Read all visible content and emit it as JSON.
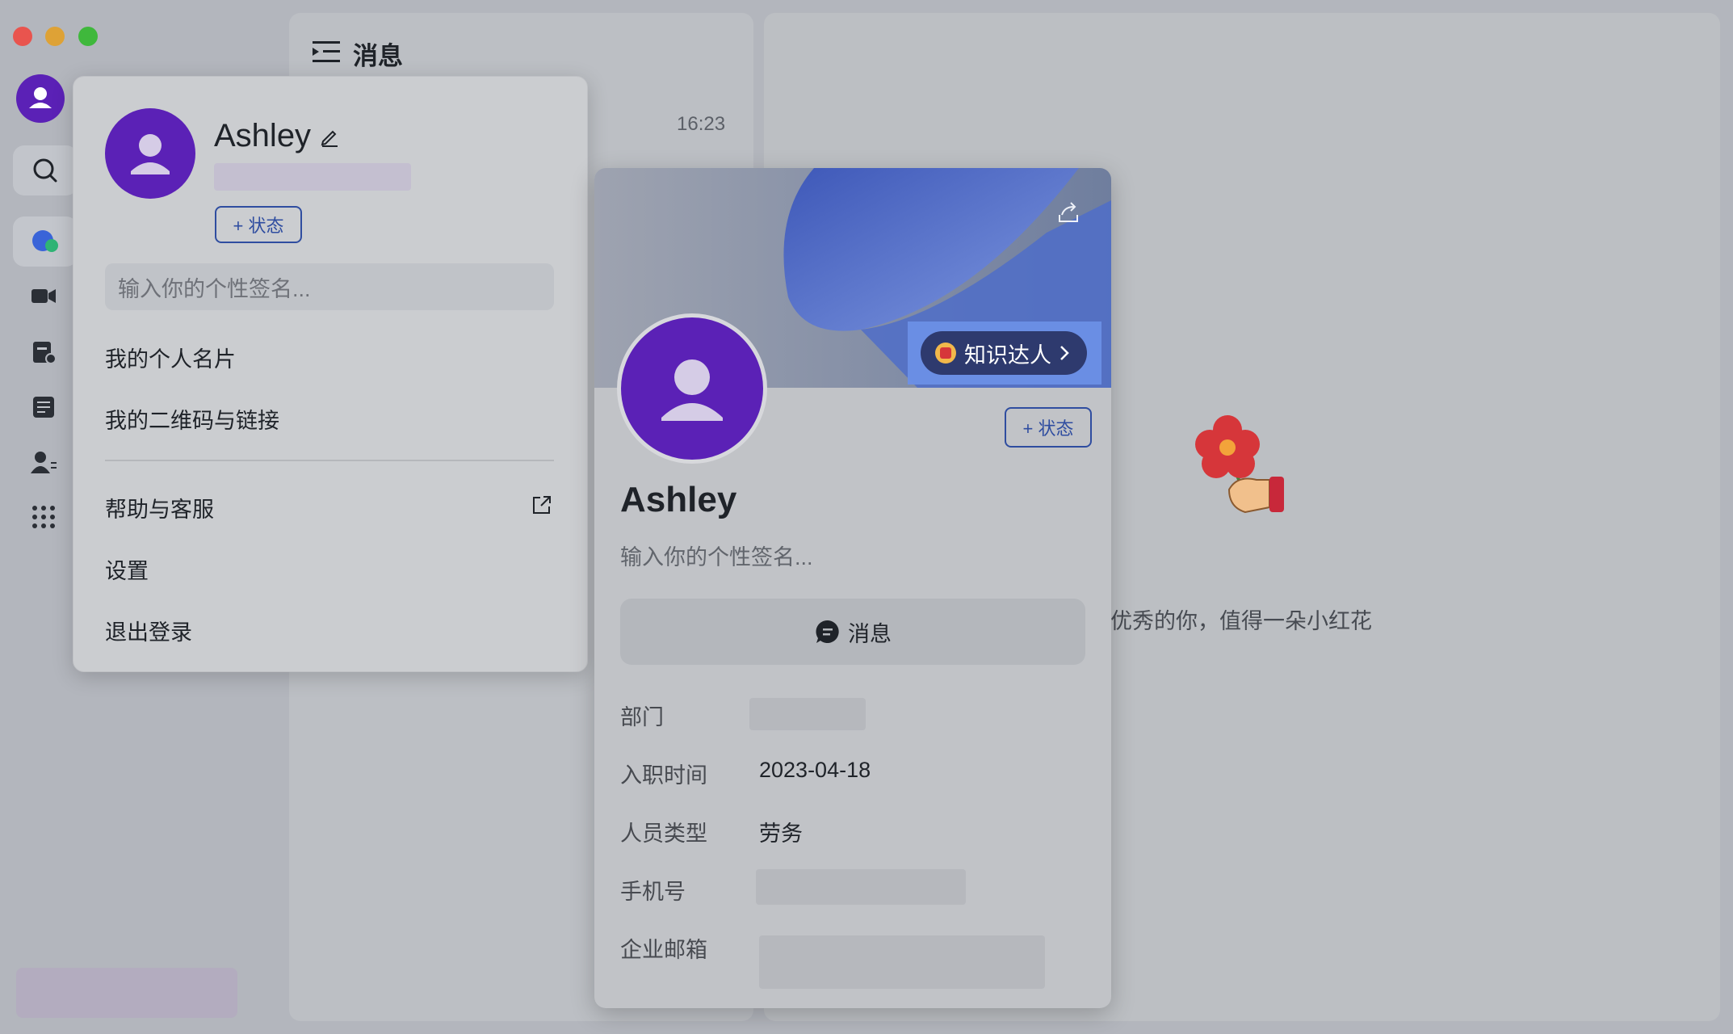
{
  "panel": {
    "title": "消息",
    "time": "16:23"
  },
  "main": {
    "empty_text": "优秀的你，值得一朵小红花"
  },
  "menu": {
    "name": "Ashley",
    "status_button": "+ 状态",
    "signature_placeholder": "输入你的个性签名...",
    "items": {
      "card": "我的个人名片",
      "qrcode": "我的二维码与链接",
      "help": "帮助与客服",
      "settings": "设置",
      "logout": "退出登录"
    }
  },
  "card": {
    "badge": "知识达人",
    "status_button": "+ 状态",
    "name": "Ashley",
    "signature_placeholder": "输入你的个性签名...",
    "message_button": "消息",
    "fields": {
      "department_label": "部门",
      "join_date_label": "入职时间",
      "join_date": "2023-04-18",
      "staff_type_label": "人员类型",
      "staff_type": "劳务",
      "phone_label": "手机号",
      "email_label": "企业邮箱"
    }
  },
  "colors": {
    "brand_purple": "#5b21b6",
    "status_blue": "#2f4da0"
  },
  "icons": [
    "message-list-icon",
    "search-icon",
    "chat-icon",
    "video-icon",
    "docs-icon",
    "calendar-icon",
    "contacts-icon",
    "apps-icon",
    "edit-icon",
    "external-link-icon",
    "share-icon",
    "badge-icon",
    "message-bubble-icon",
    "user-icon",
    "flower-icon"
  ]
}
